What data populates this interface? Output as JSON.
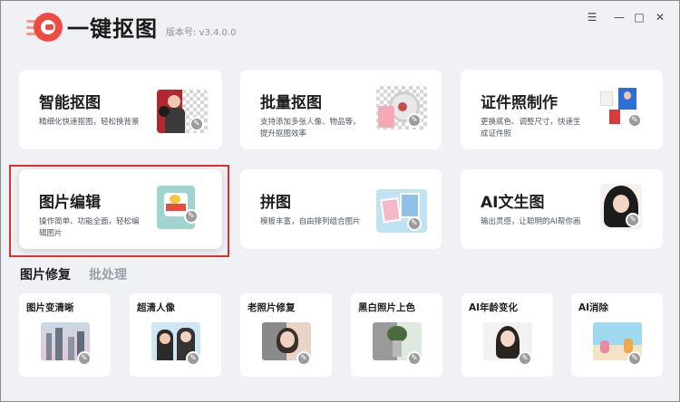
{
  "app": {
    "title": "一键抠图",
    "version": "版本号: v3.4.0.0"
  },
  "window_controls": {
    "menu": "☰",
    "minimize": "—",
    "maximize": "□",
    "close": "✕"
  },
  "cards": [
    {
      "title": "智能抠图",
      "desc": "精细化快速抠图，轻松换背景"
    },
    {
      "title": "批量抠图",
      "desc": "支持添加多张人像、物品等，提升抠图效率"
    },
    {
      "title": "证件照制作",
      "desc": "更换底色、调整尺寸，快速生成证件照"
    },
    {
      "title": "图片编辑",
      "desc": "操作简单、功能全面，轻松编辑图片"
    },
    {
      "title": "拼图",
      "desc": "模板丰富，自由排列组合图片"
    },
    {
      "title": "AI文生图",
      "desc": "输出灵感，让聪明的AI帮你画"
    }
  ],
  "tabs": {
    "active": "图片修复",
    "inactive": "批处理"
  },
  "tools": [
    {
      "title": "图片变清晰"
    },
    {
      "title": "超清人像"
    },
    {
      "title": "老照片修复"
    },
    {
      "title": "黑白照片上色"
    },
    {
      "title": "AI年龄变化"
    },
    {
      "title": "AI消除"
    }
  ],
  "icons": {
    "card_badge": "edit-badge-icon",
    "colors": {
      "accent": "#ee4b42",
      "selection": "#d9322e",
      "page_bg": "#f0f1f4"
    }
  }
}
